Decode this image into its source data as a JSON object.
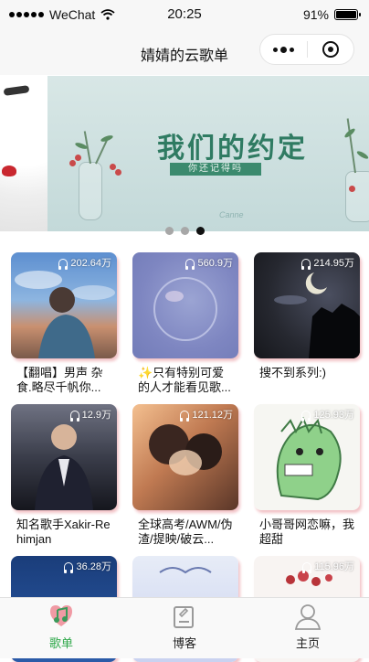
{
  "status_bar": {
    "carrier": "WeChat",
    "time": "20:25",
    "battery": "91%",
    "battery_level": 0.91
  },
  "navbar": {
    "title": "婧婧的云歌单"
  },
  "banner": {
    "title": "我们的约定",
    "subtitle": "你还记得吗",
    "signature": "Canne",
    "slide_count": 3,
    "active_index": 2
  },
  "playlists": [
    {
      "count": "202.64万",
      "title": "【翻唱】男声 杂食.略尽千帆你..."
    },
    {
      "count": "560.9万",
      "title": "✨只有特别可爱的人才能看见歌..."
    },
    {
      "count": "214.95万",
      "title": "搜不到系列:)"
    },
    {
      "count": "12.9万",
      "title": "知名歌手Xakir-Rehimjan"
    },
    {
      "count": "121.12万",
      "title": "全球高考/AWM/伪渣/提映/破云..."
    },
    {
      "count": "125.93万",
      "title": "小哥哥网恋嘛，我超甜"
    },
    {
      "count": "36.28万",
      "title": ""
    },
    {
      "count": "",
      "title": ""
    },
    {
      "count": "115.96万",
      "title": ""
    }
  ],
  "tabs": [
    {
      "label": "歌单",
      "icon": "music-note-icon",
      "active": true
    },
    {
      "label": "博客",
      "icon": "blog-edit-icon",
      "active": false
    },
    {
      "label": "主页",
      "icon": "user-icon",
      "active": false
    }
  ],
  "colors": {
    "accent": "#2fa84a",
    "banner_title": "#2f7b62"
  }
}
